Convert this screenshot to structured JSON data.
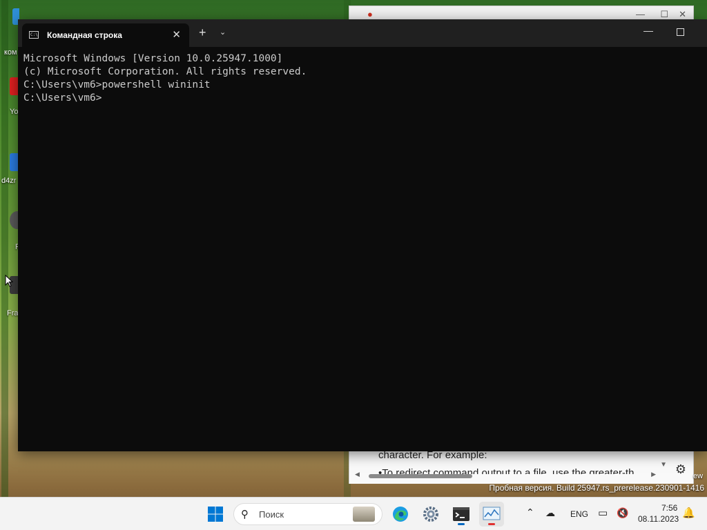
{
  "desktop": {
    "icons": [
      {
        "label": "ком",
        "color": "#2f8fd6"
      },
      {
        "label": "Yo",
        "color": "#e02020"
      },
      {
        "label": "d4zr",
        "color": "#2a7be0"
      },
      {
        "label": "P",
        "color": "#5a5a5a"
      },
      {
        "label": "Fra",
        "color": "#3c3c3c"
      }
    ]
  },
  "background_window": {
    "text_line_1": "character. For example:",
    "text_line_2": "•To redirect command output to a file, use the greater-th",
    "side_note": "ew"
  },
  "terminal": {
    "tab_title": "Командная строка",
    "tab_icon": "cmd-icon",
    "lines": [
      "Microsoft Windows [Version 10.0.25947.1000]",
      "(c) Microsoft Corporation. All rights reserved.",
      "",
      "C:\\Users\\vm6>powershell wininit",
      "",
      "C:\\Users\\vm6>"
    ]
  },
  "watermark": "Пробная версия. Build 25947.rs_prerelease.230901-1416",
  "taskbar": {
    "search_placeholder": "Поиск",
    "apps": [
      {
        "name": "start",
        "icon": "windows-logo-icon"
      },
      {
        "name": "edge",
        "icon": "edge-icon"
      },
      {
        "name": "settings",
        "icon": "gear-icon"
      },
      {
        "name": "terminal",
        "icon": "terminal-icon"
      },
      {
        "name": "resource-monitor",
        "icon": "chart-icon"
      }
    ],
    "language": "ENG",
    "time": "7:56",
    "date": "08.11.2023",
    "accent_color": "#0067c0",
    "active_indicator_color": "#e03030"
  }
}
